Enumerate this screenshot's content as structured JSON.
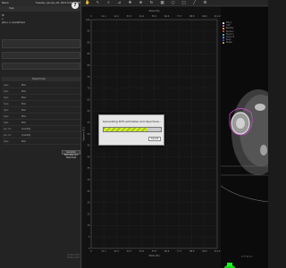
{
  "left_panel": {
    "header": {
      "title": "Name",
      "date": "Tuesday, January 20, 2015 6:02:06 PM"
    },
    "toolbar": {
      "label": "Help"
    },
    "description": {
      "line1": "fit",
      "line2": "v",
      "line3": "ption, or predefined"
    },
    "table": {
      "header": "Target Dose",
      "rows": [
        {
          "label": "Type",
          "value": "Max"
        },
        {
          "label": "Type",
          "value": "Max"
        },
        {
          "label": "Type",
          "value": "Max"
        },
        {
          "label": "Type",
          "value": "Max"
        },
        {
          "label": "Type",
          "value": "Max"
        },
        {
          "label": "Type",
          "value": "Max"
        },
        {
          "label": "Type",
          "value": "Max"
        },
        {
          "label": "per cm",
          "value": "Quantity"
        },
        {
          "label": "per cm",
          "value": "Quantity"
        },
        {
          "label": "Type",
          "value": "Max"
        }
      ]
    },
    "generate_button": "Generate Estimates and Objectives",
    "footer": {
      "line1": "Eclipse 2013",
      "line2": "Eclipse 2013"
    }
  },
  "toolbar": {
    "icons": [
      "hand-icon",
      "cursor-icon",
      "magnify-icon",
      "ruler-icon",
      "pan-icon",
      "zoom-icon",
      "rotate-icon",
      "grid-icon",
      "circle-icon",
      "square-icon",
      "line-icon",
      "settings-icon"
    ],
    "icon_glyphs": [
      "✋",
      "↖",
      "⌕",
      "⊿",
      "✥",
      "⊕",
      "↻",
      "▦",
      "○",
      "□",
      "╱",
      "⚙"
    ]
  },
  "dialog": {
    "message": "Generating DVH estimates and objectives...",
    "progress_percent": 76,
    "cancel_label": "Cancel"
  },
  "right_panel": {
    "legend": [
      {
        "label": "PTV_1",
        "color": "#e0e0e0"
      },
      {
        "label": "CTV",
        "color": "#d24bd2"
      },
      {
        "label": "Bladder",
        "color": "#d9a200"
      },
      {
        "label": "Rectum",
        "color": "#d23c3c"
      },
      {
        "label": "Femur L",
        "color": "#3cb4d2"
      },
      {
        "label": "Femur R",
        "color": "#5a8ee6"
      },
      {
        "label": "Body",
        "color": "#3c3cd2"
      },
      {
        "label": "Bowel",
        "color": "#d28c3c"
      }
    ],
    "footer": "2.77 42 cm"
  },
  "chart_data": {
    "type": "line",
    "title": "Dose [%]",
    "xlabel": "Dose [%]",
    "ylabel": "Volume [%]",
    "x_ticks": [
      "0",
      "11.1",
      "22.2",
      "33.3",
      "44.4",
      "55.5",
      "66.6",
      "77.7",
      "88.8",
      "99.9",
      "111.0"
    ],
    "y_ticks": [
      "100",
      "95",
      "90",
      "85",
      "80",
      "75",
      "70",
      "65",
      "60",
      "55",
      "50",
      "45",
      "40",
      "35",
      "30",
      "25",
      "20",
      "15",
      "10",
      "5",
      "0"
    ],
    "series": [],
    "grid": true
  }
}
